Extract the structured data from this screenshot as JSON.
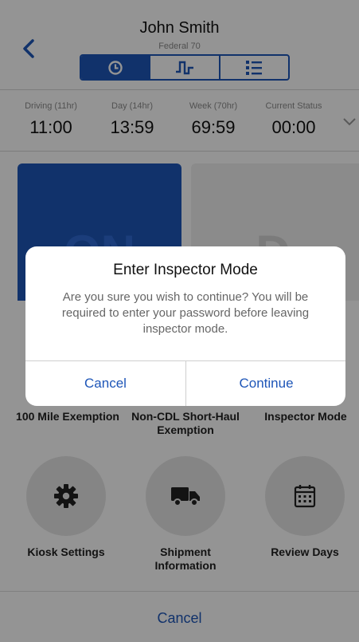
{
  "header": {
    "driver_name": "John Smith",
    "ruleset": "Federal 70",
    "tabs": [
      {
        "name": "clock-icon",
        "selected": true
      },
      {
        "name": "graph-icon",
        "selected": false
      },
      {
        "name": "list-icon",
        "selected": false
      }
    ]
  },
  "hours": [
    {
      "label": "Driving (11hr)",
      "value": "11:00"
    },
    {
      "label": "Day (14hr)",
      "value": "13:59"
    },
    {
      "label": "Week (70hr)",
      "value": "69:59"
    },
    {
      "label": "Current Status",
      "value": "00:00"
    }
  ],
  "status_tiles": {
    "on": "ON",
    "d": "D"
  },
  "actions": [
    {
      "label": "100 Mile Exemption",
      "icon": "100-mile-icon"
    },
    {
      "label": "Non-CDL Short-Haul Exemption",
      "icon": "short-haul-icon"
    },
    {
      "label": "Inspector Mode",
      "icon": "inspector-icon"
    },
    {
      "label": "Kiosk Settings",
      "icon": "gear-icon"
    },
    {
      "label": "Shipment Information",
      "icon": "truck-icon"
    },
    {
      "label": "Review Days",
      "icon": "calendar-icon"
    }
  ],
  "sheet_cancel": "Cancel",
  "dialog": {
    "title": "Enter Inspector Mode",
    "message": "Are you sure you wish to continue? You will be required to enter your password before leaving inspector mode.",
    "cancel": "Cancel",
    "continue": "Continue"
  },
  "colors": {
    "accent": "#1e56b8",
    "overlay": "rgba(0,0,0,0.42)"
  }
}
